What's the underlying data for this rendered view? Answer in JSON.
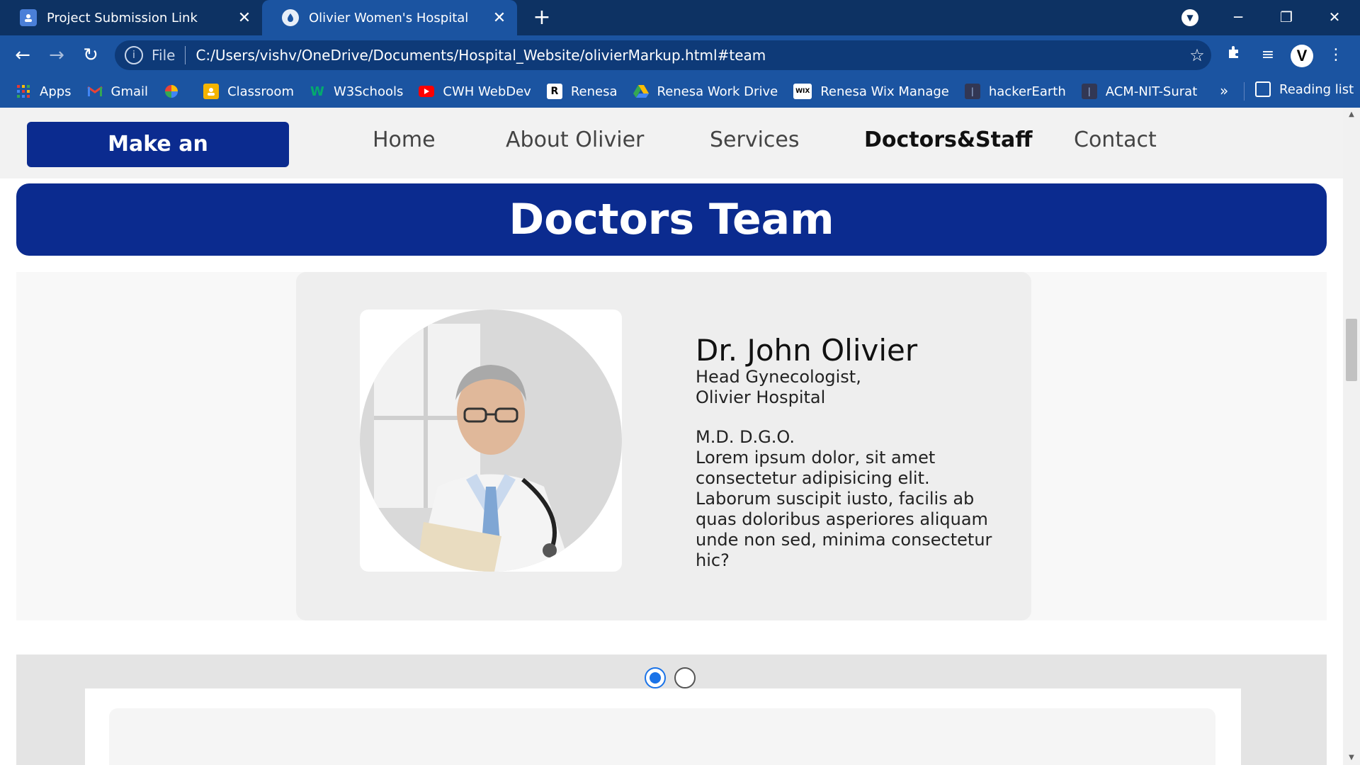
{
  "browser": {
    "tabs": [
      {
        "title": "Project Submission Link",
        "active": false
      },
      {
        "title": "Olivier Women's Hospital",
        "active": true
      }
    ],
    "new_tab": "+",
    "address": {
      "scheme": "File",
      "url": "C:/Users/vishv/OneDrive/Documents/Hospital_Website/olivierMarkup.html#team"
    },
    "profile_initial": "V",
    "bookmarks": [
      {
        "label": "Apps",
        "icon": "apps-grid-icon",
        "color": "#e53935"
      },
      {
        "label": "Gmail",
        "icon": "gmail-icon",
        "color": "#ea4335"
      },
      {
        "label": "",
        "icon": "pinwheel-icon",
        "color": "#fbbc04"
      },
      {
        "label": "Classroom",
        "icon": "classroom-icon",
        "color": "#f4b400"
      },
      {
        "label": "W3Schools",
        "icon": "w3schools-icon",
        "color": "#04aa6d"
      },
      {
        "label": "CWH WebDev",
        "icon": "youtube-icon",
        "color": "#ff0000"
      },
      {
        "label": "Renesa",
        "icon": "renesa-icon",
        "color": "#ffffff"
      },
      {
        "label": "Renesa Work Drive",
        "icon": "drive-icon",
        "color": "#34a853"
      },
      {
        "label": "Renesa Wix Manage",
        "icon": "wix-icon",
        "color": "#ffffff"
      },
      {
        "label": "hackerEarth",
        "icon": "hackerearth-icon",
        "color": "#323754"
      },
      {
        "label": "ACM-NIT-Surat",
        "icon": "acm-icon",
        "color": "#323754"
      }
    ],
    "bookmarks_overflow": "»",
    "reading_list": "Reading list"
  },
  "site": {
    "nav": {
      "cta": "Make an Appointment",
      "links": [
        "Home",
        "About Olivier",
        "Services",
        "Doctors&Staff",
        "Contact"
      ],
      "active": "Doctors&Staff"
    },
    "team_heading": "Doctors Team",
    "doctor": {
      "name": "Dr. John Olivier",
      "role_line1": "Head Gynecologist,",
      "role_line2": "Olivier Hospital",
      "degree": "M.D. D.G.O.",
      "bio": "Lorem ipsum dolor, sit amet consectetur adipisicing elit. Laborum suscipit iusto, facilis ab quas doloribus asperiores aliquam unde non sed, minima consectetur hic?",
      "photo": "doctor-portrait-image"
    },
    "carousel": {
      "slide_count": 2,
      "active_index": 0
    }
  },
  "colors": {
    "brand": "#0b2b8f",
    "chrome_dark": "#0d3263",
    "chrome": "#1b54a1",
    "indicator_active": "#1a73e8"
  }
}
